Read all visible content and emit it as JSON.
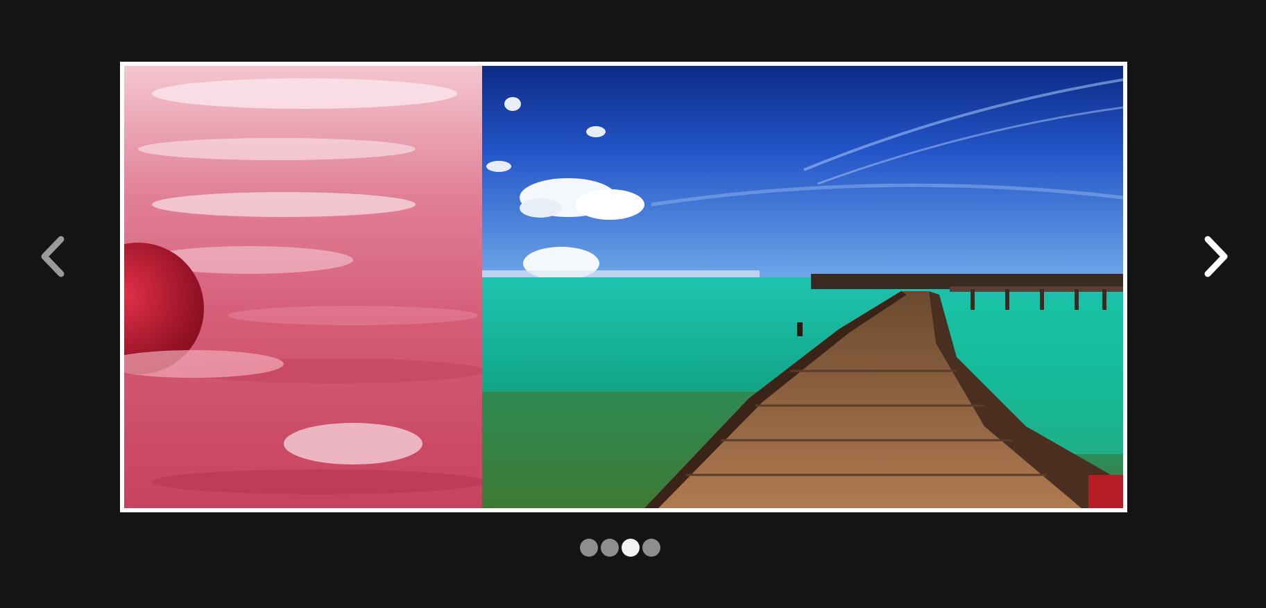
{
  "carousel": {
    "prev_icon": "chevron-left-icon",
    "next_icon": "chevron-right-icon",
    "current_slide": 3,
    "slide_count": 4,
    "slides": [
      {
        "description_icon": "slide-thumbnail"
      },
      {
        "description_icon": "slide-thumbnail"
      },
      {
        "description_icon": "pink-water-and-tropical-pier-image"
      },
      {
        "description_icon": "slide-thumbnail"
      }
    ],
    "colors": {
      "background": "#141414",
      "frame": "#ffffff",
      "dot_inactive": "#8e8e8e",
      "dot_active": "#f2f2f2",
      "arrow_prev": "#9a9a9a",
      "arrow_next": "#ffffff"
    }
  }
}
